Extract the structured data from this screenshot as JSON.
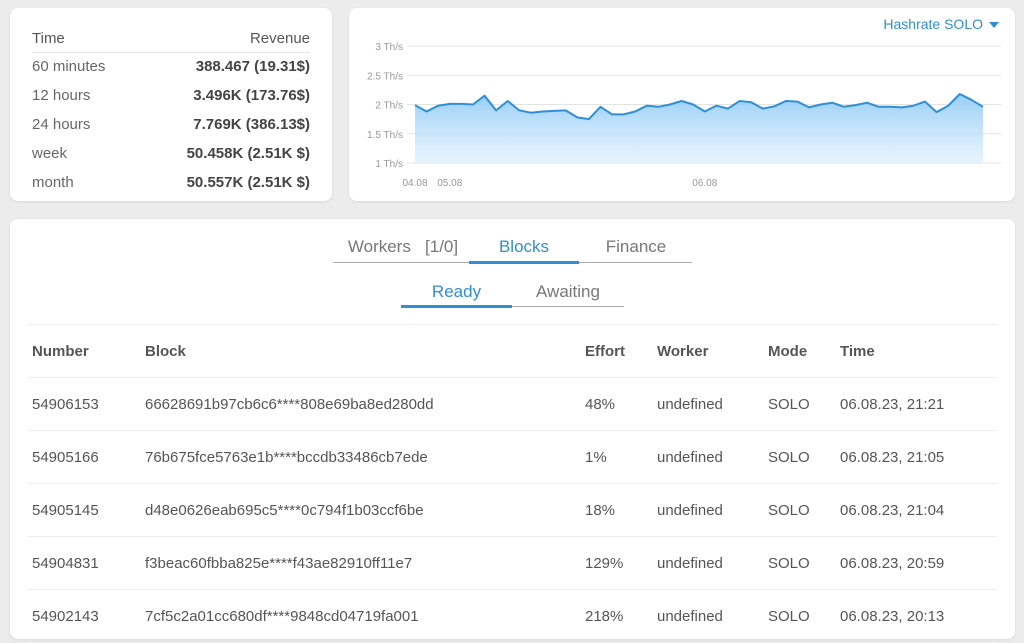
{
  "revenue": {
    "header_time": "Time",
    "header_revenue": "Revenue",
    "rows": [
      {
        "period": "60 minutes",
        "value": "388.467 (19.31$)"
      },
      {
        "period": "12 hours",
        "value": "3.496K (173.76$)"
      },
      {
        "period": "24 hours",
        "value": "7.769K (386.13$)"
      },
      {
        "period": "week",
        "value": "50.458K (2.51K $)"
      },
      {
        "period": "month",
        "value": "50.557K (2.51K $)"
      }
    ]
  },
  "hashrate_select": "Hashrate SOLO",
  "colors": {
    "accent": "#2f8fd6",
    "effort_green": "#8bc34a",
    "area_fill": "#bfe0fb"
  },
  "chart_data": {
    "type": "area",
    "ylabel": "",
    "y_ticks": [
      "3 Th/s",
      "2.5 Th/s",
      "2 Th/s",
      "1.5 Th/s",
      "1 Th/s"
    ],
    "ylim": [
      1,
      3
    ],
    "x_ticks": [
      {
        "label": "04.08",
        "at": 0
      },
      {
        "label": "05.08",
        "at": 3
      },
      {
        "label": "06.08",
        "at": 25
      }
    ],
    "grid": true,
    "values": [
      1.99,
      1.88,
      1.98,
      2.01,
      2.01,
      2.0,
      2.15,
      1.9,
      2.06,
      1.9,
      1.86,
      1.88,
      1.89,
      1.9,
      1.78,
      1.75,
      1.96,
      1.83,
      1.83,
      1.88,
      1.98,
      1.96,
      2.0,
      2.06,
      2.0,
      1.88,
      1.98,
      1.93,
      2.06,
      2.04,
      1.93,
      1.97,
      2.06,
      2.05,
      1.95,
      2.0,
      2.03,
      1.96,
      1.99,
      2.03,
      1.96,
      1.96,
      1.95,
      1.98,
      2.05,
      1.87,
      1.98,
      2.18,
      2.08,
      1.96
    ]
  },
  "tabs": [
    {
      "label": "Workers",
      "extra": "[1/0]"
    },
    {
      "label": "Blocks"
    },
    {
      "label": "Finance"
    }
  ],
  "subtabs": [
    "Ready",
    "Awaiting"
  ],
  "table": {
    "headers": [
      "Number",
      "Block",
      "Effort",
      "Worker",
      "Mode",
      "Time"
    ],
    "rows": [
      [
        "54906153",
        "66628691b97cb6c6****808e69ba8ed280dd",
        "48%",
        "undefined",
        "SOLO",
        "06.08.23, 21:21"
      ],
      [
        "54905166",
        "76b675fce5763e1b****bccdb33486cb7ede",
        "1%",
        "undefined",
        "SOLO",
        "06.08.23, 21:05"
      ],
      [
        "54905145",
        "d48e0626eab695c5****0c794f1b03ccf6be",
        "18%",
        "undefined",
        "SOLO",
        "06.08.23, 21:04"
      ],
      [
        "54904831",
        "f3beac60fbba825e****f43ae82910ff11e7",
        "129%",
        "undefined",
        "SOLO",
        "06.08.23, 20:59"
      ],
      [
        "54902143",
        "7cf5c2a01cc680df****9848cd04719fa001",
        "218%",
        "undefined",
        "SOLO",
        "06.08.23, 20:13"
      ]
    ]
  }
}
